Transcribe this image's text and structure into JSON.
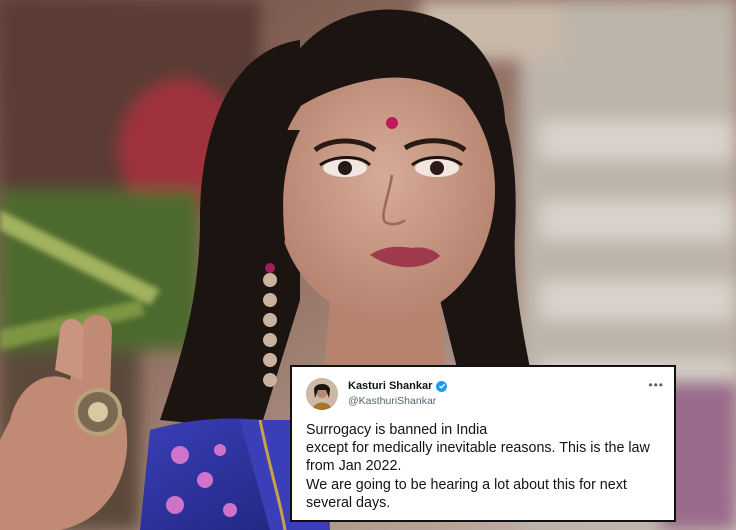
{
  "photo": {
    "subject": "woman-speaking-photo",
    "colors": {
      "background_warm": "#8a6a60",
      "background_green": "#5c7a3c",
      "hair": "#1b1411",
      "skin": "#c79a86",
      "saree_blue": "#2a2f9e",
      "saree_pink": "#e07ad0",
      "lips": "#9e3a4a",
      "bindi": "#c2185b"
    }
  },
  "tweet": {
    "author_name": "Kasturi Shankar",
    "author_handle": "@KasthuriShankar",
    "verified": true,
    "body_lines": [
      "Surrogacy is banned in India",
      "except for medically inevitable reasons. This is the law",
      "from Jan 2022.",
      "We are going to be hearing a lot about this for next",
      "several days."
    ],
    "colors": {
      "verified": "#1d9bf0",
      "text": "#0f1419",
      "handle": "#536471"
    }
  }
}
